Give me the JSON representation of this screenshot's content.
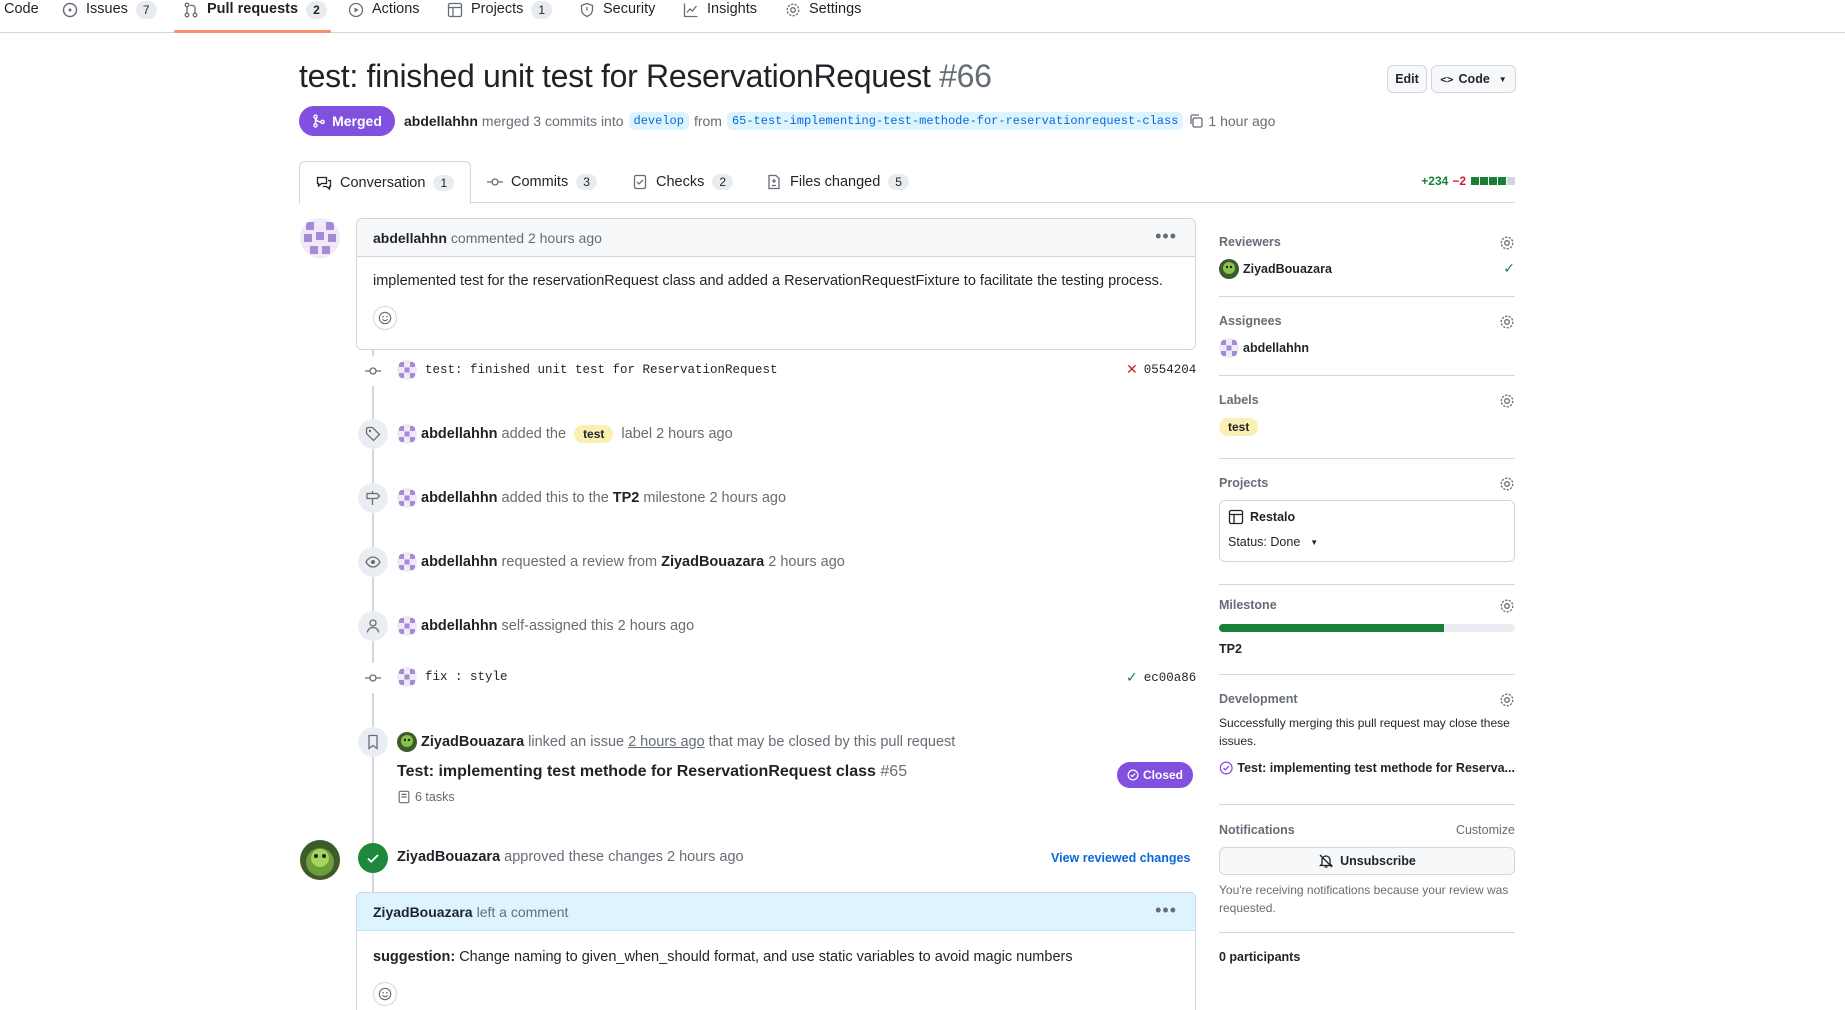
{
  "nav": {
    "items": [
      {
        "label": "Code",
        "count": ""
      },
      {
        "label": "Issues",
        "count": "7"
      },
      {
        "label": "Pull requests",
        "count": "2"
      },
      {
        "label": "Actions",
        "count": ""
      },
      {
        "label": "Projects",
        "count": "1"
      },
      {
        "label": "Security",
        "count": ""
      },
      {
        "label": "Insights",
        "count": ""
      },
      {
        "label": "Settings",
        "count": ""
      }
    ]
  },
  "header": {
    "title": "test: finished unit test for ReservationRequest",
    "number": "#66",
    "edit_label": "Edit",
    "code_label": "Code",
    "status": "Merged",
    "author": "abdellahhn",
    "merged_text": "merged 3 commits into",
    "base_branch": "develop",
    "from_text": "from",
    "head_branch": "65-test-implementing-test-methode-for-reservationrequest-class",
    "time": "1 hour ago"
  },
  "tabs": [
    {
      "label": "Conversation",
      "count": "1"
    },
    {
      "label": "Commits",
      "count": "3"
    },
    {
      "label": "Checks",
      "count": "2"
    },
    {
      "label": "Files changed",
      "count": "5"
    }
  ],
  "diffstat": {
    "additions": "+234",
    "deletions": "−2"
  },
  "timeline": {
    "first_comment": {
      "author": "abdellahhn",
      "meta": "commented 2 hours ago",
      "body": "implemented test for the reservationRequest class and added a ReservationRequestFixture to facilitate the testing process."
    },
    "commit1": {
      "message": "test: finished unit test for ReservationRequest",
      "sha": "0554204"
    },
    "label_event": {
      "author": "abdellahhn",
      "pre": "added the",
      "label": "test",
      "post": "label 2 hours ago"
    },
    "milestone_event": {
      "author": "abdellahhn",
      "pre": "added this to the",
      "milestone": "TP2",
      "post": "milestone 2 hours ago"
    },
    "review_event": {
      "author": "abdellahhn",
      "pre": "requested a review from",
      "reviewer": "ZiyadBouazara",
      "post": "2 hours ago"
    },
    "assign_event": {
      "author": "abdellahhn",
      "text": "self-assigned this 2 hours ago"
    },
    "commit2": {
      "message": "fix : style",
      "sha": "ec00a86"
    },
    "link_event": {
      "author": "ZiyadBouazara",
      "pre": "linked an issue",
      "time": "2 hours ago",
      "post": "that may be closed by this pull request",
      "issue_title": "Test: implementing test methode for ReservationRequest class",
      "issue_number": "#65",
      "tasks": "6 tasks",
      "issue_status": "Closed"
    },
    "approval": {
      "author": "ZiyadBouazara",
      "text": "approved these changes 2 hours ago",
      "view_link": "View reviewed changes"
    },
    "review_comment": {
      "author": "ZiyadBouazara",
      "meta": "left a comment",
      "body_strong": "suggestion:",
      "body": "Change naming to given_when_should format, and use static variables to avoid magic numbers"
    }
  },
  "sidebar": {
    "reviewers": {
      "title": "Reviewers",
      "name": "ZiyadBouazara"
    },
    "assignees": {
      "title": "Assignees",
      "name": "abdellahhn"
    },
    "labels": {
      "title": "Labels",
      "label": "test"
    },
    "projects": {
      "title": "Projects",
      "project": "Restalo",
      "status": "Status: Done"
    },
    "milestone": {
      "title": "Milestone",
      "name": "TP2",
      "progress": 0.76
    },
    "development": {
      "title": "Development",
      "text": "Successfully merging this pull request may close these issues.",
      "issue": "Test: implementing test methode for Reserva..."
    },
    "notifications": {
      "title": "Notifications",
      "customize": "Customize",
      "button": "Unsubscribe",
      "text": "You're receiving notifications because your review was requested."
    },
    "participants": "0 participants"
  },
  "colors": {
    "merged": "#8250df",
    "success": "#1a7f37",
    "danger": "#cf222e",
    "link": "#0969da"
  }
}
